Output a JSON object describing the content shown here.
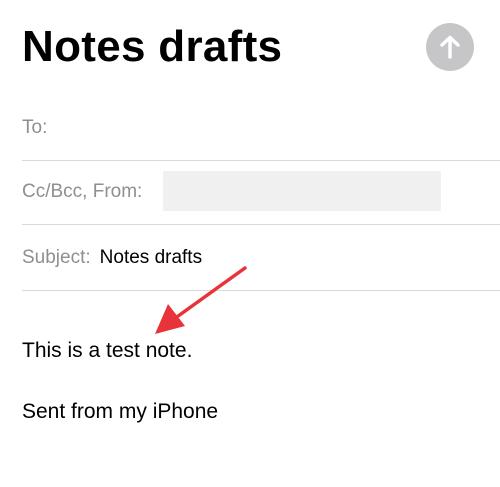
{
  "header": {
    "title": "Notes drafts",
    "send_icon": "arrow-up-icon"
  },
  "fields": {
    "to_label": "To:",
    "cc_from_label": "Cc/Bcc, From:",
    "subject_label": "Subject:",
    "subject_value": "Notes drafts"
  },
  "body": {
    "note": "This is a test note.",
    "signature": "Sent from my iPhone"
  },
  "colors": {
    "send_button": "#c6c6c8",
    "annotation_arrow": "#e8333a",
    "label": "#8e8e93"
  }
}
